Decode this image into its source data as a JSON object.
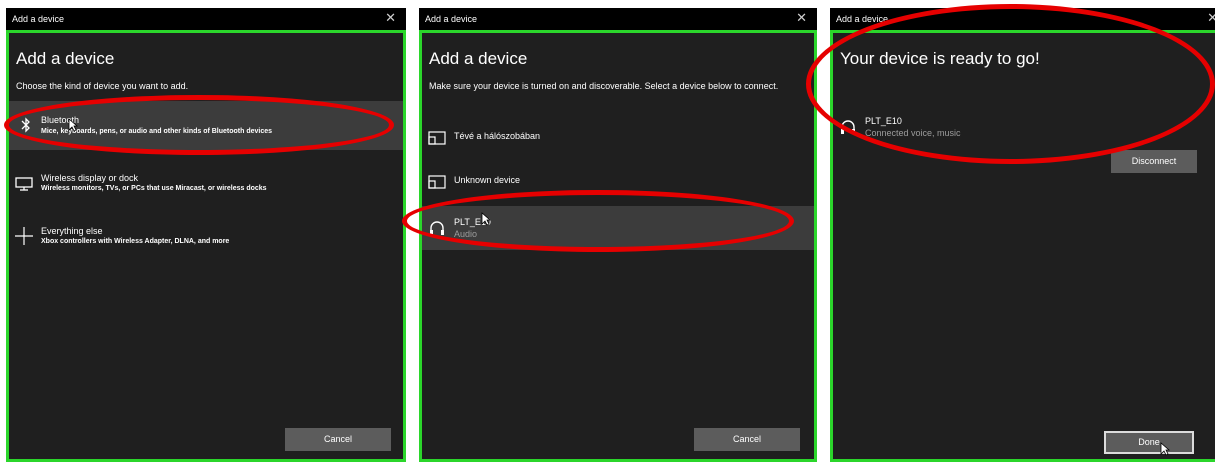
{
  "window_title": "Add a device",
  "close_glyph": "✕",
  "panel1": {
    "heading": "Add a device",
    "instruction": "Choose the kind of device you want to add.",
    "options": [
      {
        "icon": "bluetooth-icon",
        "title": "Bluetooth",
        "desc": "Mice, keyboards, pens, or audio and other kinds of Bluetooth devices",
        "selected": true
      },
      {
        "icon": "monitor-icon",
        "title": "Wireless display or dock",
        "desc": "Wireless monitors, TVs, or PCs that use Miracast, or wireless docks",
        "selected": false
      },
      {
        "icon": "plus-icon",
        "title": "Everything else",
        "desc": "Xbox controllers with Wireless Adapter, DLNA, and more",
        "selected": false
      }
    ],
    "cancel_label": "Cancel"
  },
  "panel2": {
    "heading": "Add a device",
    "instruction": "Make sure your device is turned on and discoverable. Select a device below to connect.",
    "devices": [
      {
        "icon": "media-device-icon",
        "name": "Tévé a hálószobában",
        "type": ""
      },
      {
        "icon": "media-device-icon",
        "name": "Unknown device",
        "type": ""
      },
      {
        "icon": "headset-icon",
        "name": "PLT_E10",
        "type": "Audio"
      }
    ],
    "cancel_label": "Cancel"
  },
  "panel3": {
    "heading": "Your device is ready to go!",
    "device": {
      "icon": "headset-icon",
      "name": "PLT_E10",
      "status": "Connected voice, music"
    },
    "disconnect_label": "Disconnect",
    "done_label": "Done"
  },
  "colors": {
    "highlight_border": "#2bd62b",
    "annotation": "#e60000",
    "window_bg": "#1f1f1f",
    "selected_row": "#3c3c3c"
  }
}
